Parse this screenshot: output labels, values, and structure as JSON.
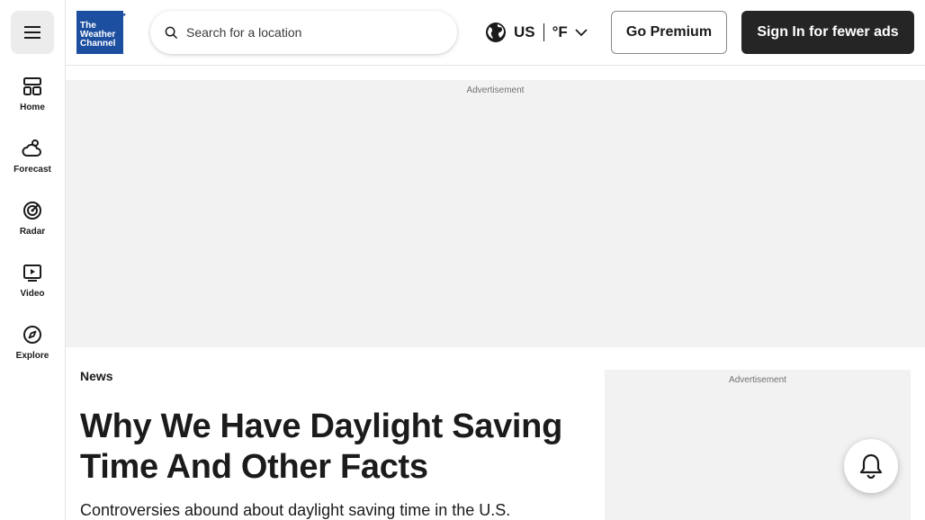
{
  "sidebar": {
    "menu_icon": "hamburger-menu-icon",
    "items": [
      {
        "label": "Home",
        "icon": "home-grid-icon"
      },
      {
        "label": "Forecast",
        "icon": "cloud-sun-icon"
      },
      {
        "label": "Radar",
        "icon": "radar-icon"
      },
      {
        "label": "Video",
        "icon": "play-video-icon"
      },
      {
        "label": "Explore",
        "icon": "compass-icon"
      }
    ]
  },
  "header": {
    "logo_text": [
      "The",
      "Weather",
      "Channel"
    ],
    "search_placeholder": "Search for a location",
    "region": "US",
    "unit": "°F",
    "premium_label": "Go Premium",
    "signin_label": "Sign In for fewer ads"
  },
  "ads": {
    "top_label": "Advertisement",
    "right_label": "Advertisement"
  },
  "article": {
    "category": "News",
    "headline": "Why We Have Daylight Saving Time And Other Facts",
    "subhead": "Controversies abound about daylight saving time in the U.S."
  },
  "colors": {
    "brand_blue": "#1d4fa0",
    "dark_button": "#252525",
    "ad_background": "#f2f2f2"
  }
}
